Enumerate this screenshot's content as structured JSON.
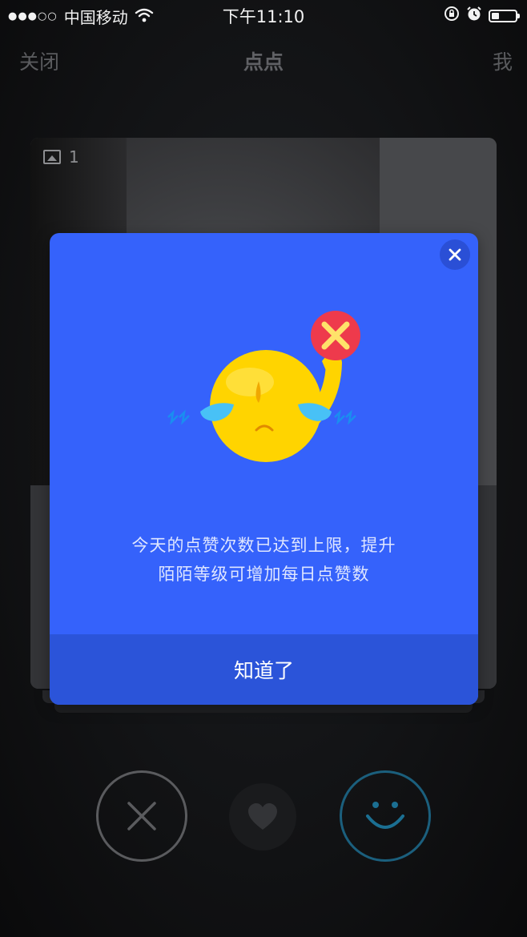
{
  "status_bar": {
    "signal": "●●●○○",
    "carrier": "中国移动",
    "time": "下午11:10",
    "icons": [
      "wifi-icon",
      "orientation-lock-icon",
      "alarm-icon",
      "battery-icon"
    ]
  },
  "nav": {
    "close_label": "关闭",
    "title": "点点",
    "me_label": "我"
  },
  "card": {
    "photo_count": "1"
  },
  "actions": {
    "dislike_icon": "close-icon",
    "like_icon": "heart-icon",
    "smile_icon": "smile-icon"
  },
  "modal": {
    "close_icon": "close-icon",
    "illustration": "crying-face-with-reject-sign",
    "message_line1": "今天的点赞次数已达到上限，提升",
    "message_line2": "陌陌等级可增加每日点赞数",
    "ok_label": "知道了"
  },
  "colors": {
    "modal_bg": "#3562fb",
    "modal_button_bg": "#2b54d9",
    "emoji_yellow": "#ffd400",
    "reject_red": "#ee3a4c",
    "tear_blue": "#48c1f6"
  }
}
